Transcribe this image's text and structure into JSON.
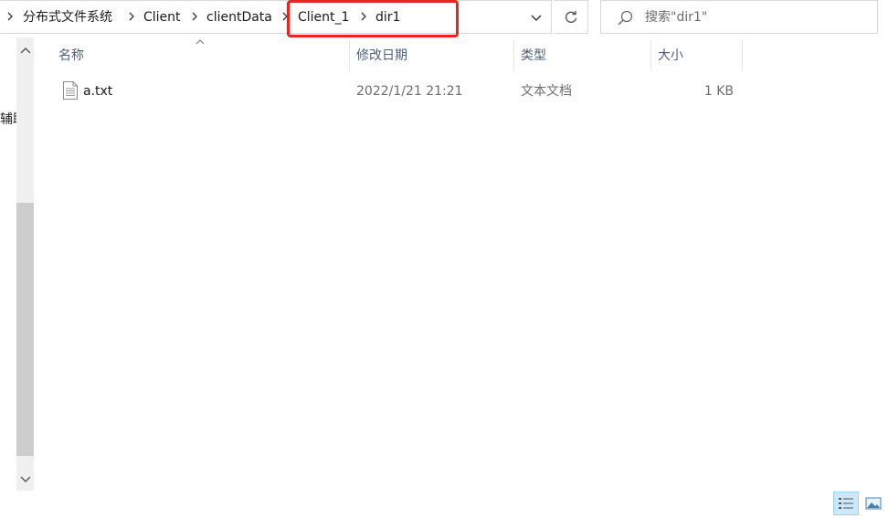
{
  "address_bar": {
    "crumbs": [
      "分布式文件系统",
      "Client",
      "clientData",
      "Client_1",
      "dir1"
    ]
  },
  "search": {
    "placeholder": "搜索\"dir1\""
  },
  "left_pane": {
    "partial_text": "辅助"
  },
  "columns": {
    "name": "名称",
    "modified": "修改日期",
    "type": "类型",
    "size": "大小"
  },
  "files": [
    {
      "name": "a.txt",
      "modified": "2022/1/21 21:21",
      "type": "文本文档",
      "size": "1 KB"
    }
  ],
  "icons": {
    "breadcrumb_separator": "chevron-right-icon",
    "dropdown": "chevron-down-icon",
    "refresh": "refresh-icon",
    "search": "search-icon",
    "file": "text-file-icon",
    "sort": "sort-up-icon",
    "view_details": "details-view-icon",
    "view_thumbnails": "large-icons-view-icon"
  },
  "colors": {
    "highlight": "#e8251e",
    "header_text": "#4c607a",
    "selected_view_bg": "#cce8ff"
  }
}
